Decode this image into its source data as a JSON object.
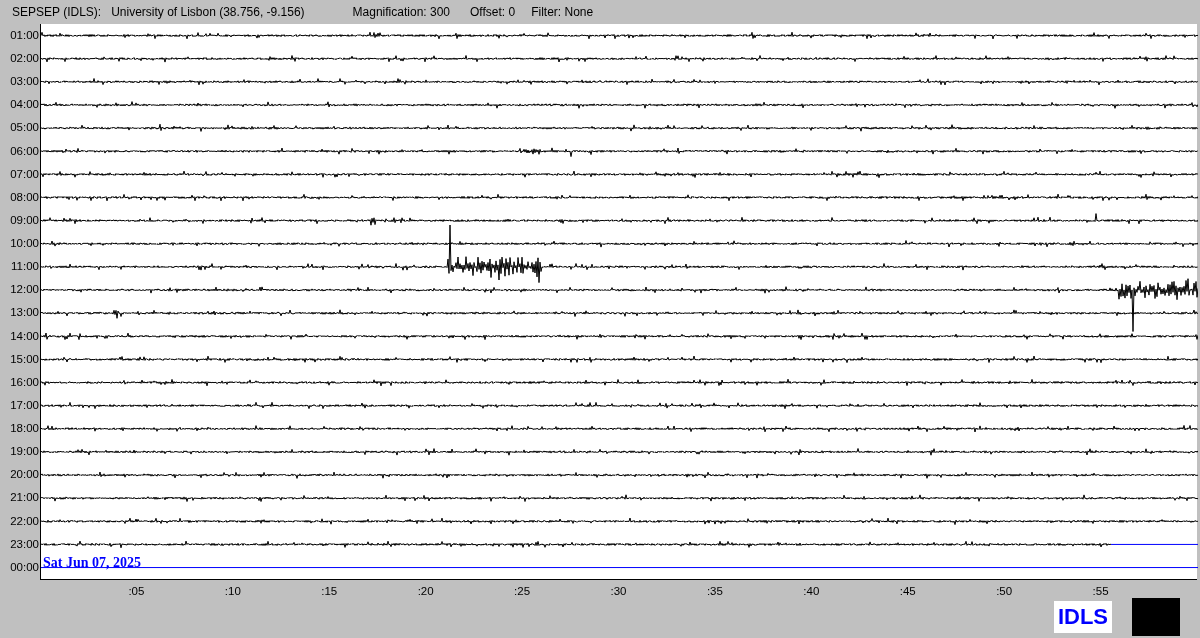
{
  "header": {
    "station": "SEPSEP (IDLS):",
    "location": "University of Lisbon (38.756, -9.156)",
    "magnification": "Magnification: 300",
    "offset": "Offset: 0",
    "filter": "Filter: None"
  },
  "rows": [
    "01:00",
    "02:00",
    "03:00",
    "04:00",
    "05:00",
    "06:00",
    "07:00",
    "08:00",
    "09:00",
    "10:00",
    "11:00",
    "12:00",
    "13:00",
    "14:00",
    "15:00",
    "16:00",
    "17:00",
    "18:00",
    "19:00",
    "20:00",
    "21:00",
    "22:00",
    "23:00",
    "00:00"
  ],
  "date_label": "Sat Jun 07, 2025",
  "x_ticks": [
    ":05",
    ":10",
    ":15",
    ":20",
    ":25",
    ":30",
    ":35",
    ":40",
    ":45",
    ":50",
    ":55"
  ],
  "station_code": "IDLS"
}
